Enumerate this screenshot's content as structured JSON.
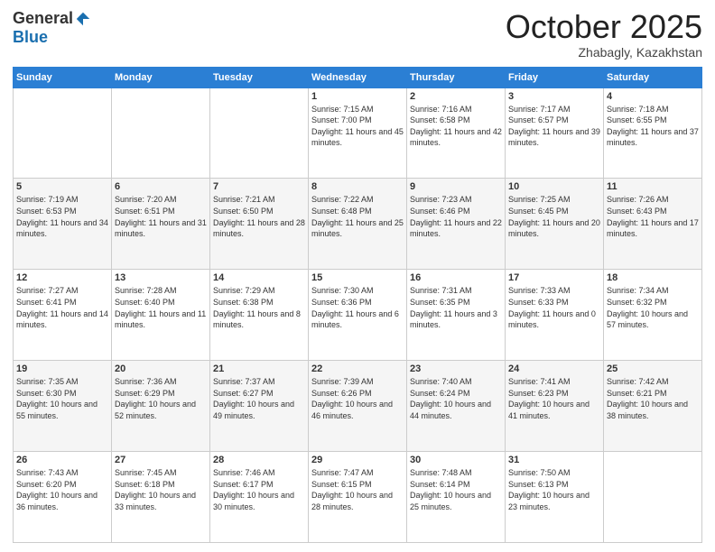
{
  "logo": {
    "general": "General",
    "blue": "Blue"
  },
  "header": {
    "month": "October 2025",
    "location": "Zhabagly, Kazakhstan"
  },
  "weekdays": [
    "Sunday",
    "Monday",
    "Tuesday",
    "Wednesday",
    "Thursday",
    "Friday",
    "Saturday"
  ],
  "weeks": [
    [
      {
        "day": "",
        "info": ""
      },
      {
        "day": "",
        "info": ""
      },
      {
        "day": "",
        "info": ""
      },
      {
        "day": "1",
        "info": "Sunrise: 7:15 AM\nSunset: 7:00 PM\nDaylight: 11 hours and 45 minutes."
      },
      {
        "day": "2",
        "info": "Sunrise: 7:16 AM\nSunset: 6:58 PM\nDaylight: 11 hours and 42 minutes."
      },
      {
        "day": "3",
        "info": "Sunrise: 7:17 AM\nSunset: 6:57 PM\nDaylight: 11 hours and 39 minutes."
      },
      {
        "day": "4",
        "info": "Sunrise: 7:18 AM\nSunset: 6:55 PM\nDaylight: 11 hours and 37 minutes."
      }
    ],
    [
      {
        "day": "5",
        "info": "Sunrise: 7:19 AM\nSunset: 6:53 PM\nDaylight: 11 hours and 34 minutes."
      },
      {
        "day": "6",
        "info": "Sunrise: 7:20 AM\nSunset: 6:51 PM\nDaylight: 11 hours and 31 minutes."
      },
      {
        "day": "7",
        "info": "Sunrise: 7:21 AM\nSunset: 6:50 PM\nDaylight: 11 hours and 28 minutes."
      },
      {
        "day": "8",
        "info": "Sunrise: 7:22 AM\nSunset: 6:48 PM\nDaylight: 11 hours and 25 minutes."
      },
      {
        "day": "9",
        "info": "Sunrise: 7:23 AM\nSunset: 6:46 PM\nDaylight: 11 hours and 22 minutes."
      },
      {
        "day": "10",
        "info": "Sunrise: 7:25 AM\nSunset: 6:45 PM\nDaylight: 11 hours and 20 minutes."
      },
      {
        "day": "11",
        "info": "Sunrise: 7:26 AM\nSunset: 6:43 PM\nDaylight: 11 hours and 17 minutes."
      }
    ],
    [
      {
        "day": "12",
        "info": "Sunrise: 7:27 AM\nSunset: 6:41 PM\nDaylight: 11 hours and 14 minutes."
      },
      {
        "day": "13",
        "info": "Sunrise: 7:28 AM\nSunset: 6:40 PM\nDaylight: 11 hours and 11 minutes."
      },
      {
        "day": "14",
        "info": "Sunrise: 7:29 AM\nSunset: 6:38 PM\nDaylight: 11 hours and 8 minutes."
      },
      {
        "day": "15",
        "info": "Sunrise: 7:30 AM\nSunset: 6:36 PM\nDaylight: 11 hours and 6 minutes."
      },
      {
        "day": "16",
        "info": "Sunrise: 7:31 AM\nSunset: 6:35 PM\nDaylight: 11 hours and 3 minutes."
      },
      {
        "day": "17",
        "info": "Sunrise: 7:33 AM\nSunset: 6:33 PM\nDaylight: 11 hours and 0 minutes."
      },
      {
        "day": "18",
        "info": "Sunrise: 7:34 AM\nSunset: 6:32 PM\nDaylight: 10 hours and 57 minutes."
      }
    ],
    [
      {
        "day": "19",
        "info": "Sunrise: 7:35 AM\nSunset: 6:30 PM\nDaylight: 10 hours and 55 minutes."
      },
      {
        "day": "20",
        "info": "Sunrise: 7:36 AM\nSunset: 6:29 PM\nDaylight: 10 hours and 52 minutes."
      },
      {
        "day": "21",
        "info": "Sunrise: 7:37 AM\nSunset: 6:27 PM\nDaylight: 10 hours and 49 minutes."
      },
      {
        "day": "22",
        "info": "Sunrise: 7:39 AM\nSunset: 6:26 PM\nDaylight: 10 hours and 46 minutes."
      },
      {
        "day": "23",
        "info": "Sunrise: 7:40 AM\nSunset: 6:24 PM\nDaylight: 10 hours and 44 minutes."
      },
      {
        "day": "24",
        "info": "Sunrise: 7:41 AM\nSunset: 6:23 PM\nDaylight: 10 hours and 41 minutes."
      },
      {
        "day": "25",
        "info": "Sunrise: 7:42 AM\nSunset: 6:21 PM\nDaylight: 10 hours and 38 minutes."
      }
    ],
    [
      {
        "day": "26",
        "info": "Sunrise: 7:43 AM\nSunset: 6:20 PM\nDaylight: 10 hours and 36 minutes."
      },
      {
        "day": "27",
        "info": "Sunrise: 7:45 AM\nSunset: 6:18 PM\nDaylight: 10 hours and 33 minutes."
      },
      {
        "day": "28",
        "info": "Sunrise: 7:46 AM\nSunset: 6:17 PM\nDaylight: 10 hours and 30 minutes."
      },
      {
        "day": "29",
        "info": "Sunrise: 7:47 AM\nSunset: 6:15 PM\nDaylight: 10 hours and 28 minutes."
      },
      {
        "day": "30",
        "info": "Sunrise: 7:48 AM\nSunset: 6:14 PM\nDaylight: 10 hours and 25 minutes."
      },
      {
        "day": "31",
        "info": "Sunrise: 7:50 AM\nSunset: 6:13 PM\nDaylight: 10 hours and 23 minutes."
      },
      {
        "day": "",
        "info": ""
      }
    ]
  ]
}
